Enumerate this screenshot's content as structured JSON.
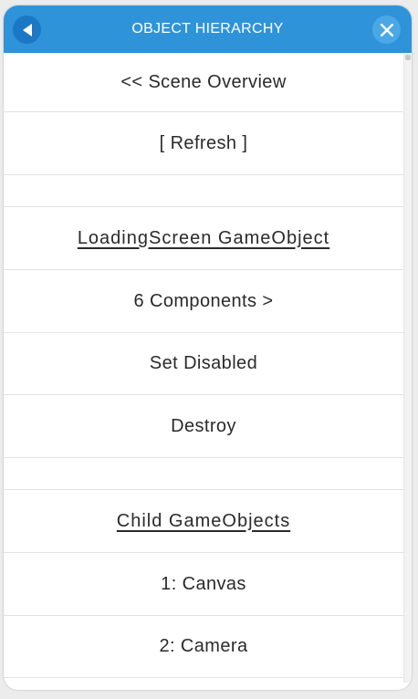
{
  "header": {
    "title": "OBJECT HIERARCHY",
    "back_icon": "back-arrow-icon",
    "close_icon": "close-icon",
    "color": "#2f93d9"
  },
  "rows": [
    {
      "label": "<< Scene Overview",
      "kind": "link"
    },
    {
      "label": "[ Refresh ]",
      "kind": "button"
    },
    {
      "label": "",
      "kind": "spacer"
    },
    {
      "label": "LoadingScreen GameObject",
      "kind": "heading"
    },
    {
      "label": "6 Components >",
      "kind": "button"
    },
    {
      "label": "Set Disabled",
      "kind": "button"
    },
    {
      "label": "Destroy",
      "kind": "button"
    },
    {
      "label": "",
      "kind": "spacer"
    },
    {
      "label": "Child GameObjects",
      "kind": "heading"
    },
    {
      "label": "1: Canvas",
      "kind": "button"
    },
    {
      "label": "2: Camera",
      "kind": "button"
    }
  ]
}
